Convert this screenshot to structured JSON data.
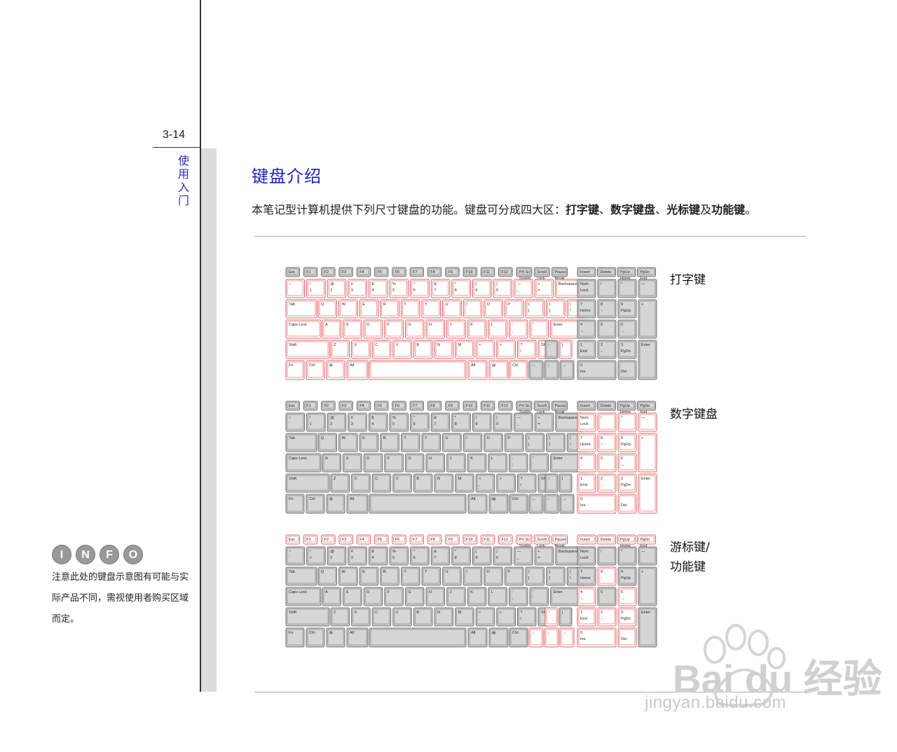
{
  "page": {
    "number": "3-14",
    "side_title": "使用入门",
    "heading": "键盘介绍",
    "intro_plain_1": "本笔记型计算机提供下列尺寸键盘的功能。键盘可分成四大区：",
    "intro_bold_1": "打字键",
    "intro_sep_1": "、",
    "intro_bold_2": "数字键盘",
    "intro_sep_2": "、",
    "intro_bold_3": "光标键",
    "intro_plain_2": "及",
    "intro_bold_4": "功能键",
    "intro_end": "。"
  },
  "keyboards": [
    {
      "label": "打字键",
      "highlight": "typing"
    },
    {
      "label": "数字键盘",
      "highlight": "numpad"
    },
    {
      "label": "游标键/\n功能键",
      "highlight": "cursor-function"
    }
  ],
  "keyboard_label_3_line1": "游标键/",
  "keyboard_label_3_line2": "功能键",
  "keys": {
    "fn_row": [
      "Esc",
      "F1",
      "F2",
      "F3",
      "F4",
      "F5",
      "F6",
      "F7",
      "F8",
      "F9",
      "F10",
      "F11",
      "F12",
      "Prt Sc\nSysRq",
      "Scroll\nLock",
      "Pause\nBreak"
    ],
    "nav_row": [
      "Insert",
      "Delete",
      "PgUp\nHome",
      "PgDn\nEnd"
    ],
    "num_row": [
      [
        "~",
        "`"
      ],
      [
        "!",
        "1"
      ],
      [
        "@",
        "2"
      ],
      [
        "#",
        "3"
      ],
      [
        "$",
        "4"
      ],
      [
        "%",
        "5"
      ],
      [
        "^",
        "6"
      ],
      [
        "&",
        "7"
      ],
      [
        "*",
        "8"
      ],
      [
        "(",
        "9"
      ],
      [
        ")",
        "0"
      ],
      [
        "—",
        "_"
      ],
      [
        "+",
        "="
      ]
    ],
    "backspace": "Backspace",
    "top_row": [
      "Q",
      "W",
      "E",
      "R",
      "T",
      "Y",
      "U",
      "I",
      "O",
      "P"
    ],
    "top_punct": [
      [
        "{",
        "["
      ],
      [
        "}",
        "]"
      ],
      [
        "|",
        "\\"
      ]
    ],
    "tab": "Tab",
    "home_row": [
      "A",
      "S",
      "D",
      "F",
      "G",
      "H",
      "J",
      "K",
      "L"
    ],
    "home_punct": [
      [
        ":",
        ";"
      ],
      [
        "\"",
        "'"
      ]
    ],
    "caps": "Caps Lock",
    "enter": "Enter",
    "bottom_row": [
      "Z",
      "X",
      "C",
      "V",
      "B",
      "N",
      "M"
    ],
    "bottom_punct": [
      [
        "<",
        ","
      ],
      [
        ">",
        "."
      ],
      [
        "?",
        "/"
      ]
    ],
    "shift": "Shift",
    "space_row": [
      "Fn",
      "Ctrl",
      "Alt",
      "Alt",
      "Ctrl"
    ],
    "numpad": {
      "r1": [
        "Num\nLock",
        "/",
        "*",
        "—"
      ],
      "r2": [
        [
          "7",
          "Home"
        ],
        [
          "8",
          "↑"
        ],
        [
          "9",
          "PgUp"
        ]
      ],
      "r3": [
        [
          "4",
          "←"
        ],
        [
          "5",
          ""
        ],
        [
          "6",
          "→"
        ]
      ],
      "r4": [
        [
          "1",
          "End"
        ],
        [
          "2",
          "↓"
        ],
        [
          "3",
          "PgDn"
        ]
      ],
      "r5": [
        [
          "0",
          "Ins"
        ],
        [
          ".",
          "Del"
        ]
      ],
      "plus": "+",
      "enter": "Enter"
    }
  },
  "info": {
    "icon_letters": [
      "I",
      "N",
      "F",
      "O"
    ],
    "text": "注意此处的键盘示意图有可能与实际产品不同，需视使用者购买区域而定。"
  },
  "watermark": {
    "brand": "Bai du 经验",
    "url": "jingyan.baidu.com"
  },
  "colors": {
    "heading": "#1f1fc0",
    "highlight_stroke": "#d33",
    "key_fill_gray": "#c8c8c8",
    "key_fill_white": "#ffffff"
  }
}
